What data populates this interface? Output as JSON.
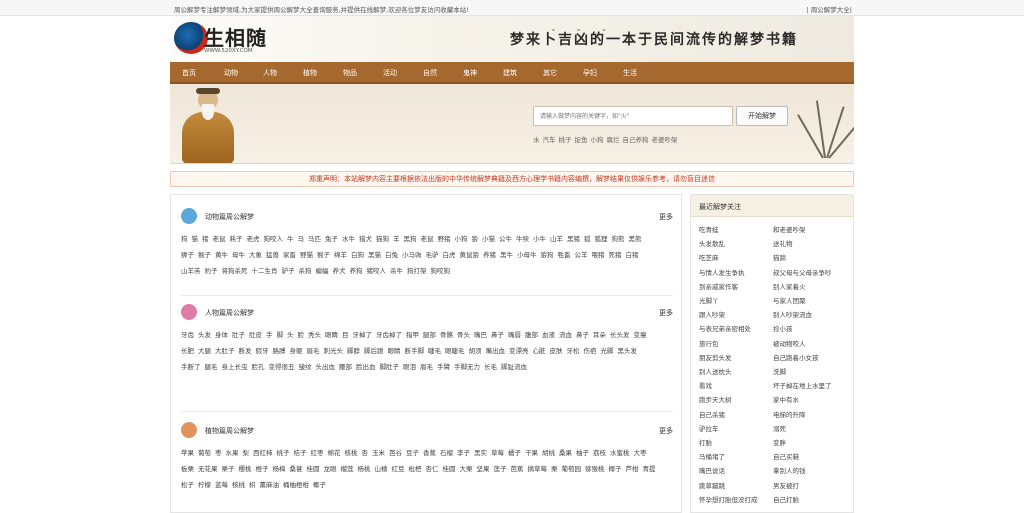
{
  "topbar": {
    "notice": "周公解梦专注解梦领域,为大家提供周公解梦大全查询服务,并提供在线解梦,欢迎各位梦友访问收藏本站!",
    "right_link": "| 周公解梦大全|"
  },
  "header": {
    "logo_name": "生相随",
    "logo_url": "WWW.520XY.COM",
    "slogan": "梦来卜吉凶的一本于民间流传的解梦书籍"
  },
  "nav": [
    "首页",
    "动物",
    "人物",
    "植物",
    "物品",
    "活动",
    "自然",
    "鬼神",
    "建筑",
    "其它",
    "孕妇",
    "生活"
  ],
  "search": {
    "placeholder": "请输入做梦内容的关键字，如\"火\"",
    "button_label": "开始解梦",
    "hot_words": [
      "水",
      "汽车",
      "桃子",
      "捉鱼",
      "小狗",
      "腐烂",
      "自己养狗",
      "老婆吵架"
    ]
  },
  "disclaimer": "郑重声明：本站解梦内容主要根据依法出版的中华传统解梦典籍及西方心理学书籍内容编撰，解梦结果仅供娱乐参考，请勿盲目迷信",
  "sections": [
    {
      "title": "动物篇周公解梦",
      "more": "更多",
      "icon_color": "#5aa9d8",
      "words": [
        "狗",
        "猫",
        "猪",
        "老鼠",
        "耗子",
        "老虎",
        "狗咬人",
        "牛",
        "马",
        "马匹",
        "兔子",
        "水牛",
        "猎犬",
        "猫狗",
        "羊",
        "黑狗",
        "老鼠",
        "野猪",
        "小狗",
        "狼",
        "小猫",
        "公牛",
        "牛犊",
        "小牛",
        "山羊",
        "黑猪",
        "狐",
        "狐狸",
        "狗熊",
        "黑熊",
        "狮子",
        "猴子",
        "黄牛",
        "母牛",
        "大象",
        "猛兽",
        "家畜",
        "野猫",
        "猴子",
        "绵羊",
        "白狗",
        "黑猫",
        "白兔",
        "小马驹",
        "毛驴",
        "白虎",
        "黄鼠狼",
        "养猪",
        "黑牛",
        "小母牛",
        "狼狗",
        "牲畜",
        "公羊",
        "喂猪",
        "死猪",
        "白猪",
        "山羊羔",
        "豹子",
        "将狗杀死",
        "十二生肖",
        "驴子",
        "杀狗",
        "蝙蝠",
        "养犬",
        "养狗",
        "猪咬人",
        "杀牛",
        "狗打架",
        "狗咬狗"
      ]
    },
    {
      "title": "人物篇周公解梦",
      "more": "更多",
      "icon_color": "#e07aa8",
      "words": [
        "牙齿",
        "头发",
        "身体",
        "肚子",
        "肚皮",
        "手",
        "脚",
        "头",
        "脸",
        "秃头",
        "眼睛",
        "目",
        "牙掉了",
        "牙齿掉了",
        "指甲",
        "腿部",
        "骨骼",
        "骨头",
        "嘴巴",
        "鼻子",
        "嘴唇",
        "腹部",
        "血液",
        "流血",
        "鼻子",
        "耳朵",
        "长头发",
        "变瘦",
        "长肥",
        "大腿",
        "大肚子",
        "断发",
        "假牙",
        "胳膊",
        "身躯",
        "眉毛",
        "刺光头",
        "脚脖",
        "脚后跟",
        "眼睛",
        "断手脚",
        "睫毛",
        "眼睫毛",
        "胡须",
        "嘴出血",
        "变漂亮",
        "心脏",
        "皮肤",
        "牙松",
        "伤疤",
        "光脚",
        "黑头发",
        "手断了",
        "腿毛",
        "身上长虫",
        "脸孔",
        "变得很丑",
        "皱纹",
        "头出血",
        "腰部",
        "脸出血",
        "脚肚子",
        "眼泪",
        "眉毛",
        "手臂",
        "手脚无力",
        "长毛",
        "脚趾流血"
      ]
    },
    {
      "title": "植物篇周公解梦",
      "more": "更多",
      "icon_color": "#e0935a",
      "words": [
        "苹果",
        "葡萄",
        "枣",
        "水果",
        "梨",
        "西红柿",
        "桃子",
        "桔子",
        "红枣",
        "棉花",
        "核桃",
        "杏",
        "玉米",
        "芭谷",
        "豆子",
        "香蕉",
        "石榴",
        "李子",
        "黑实",
        "草莓",
        "橘子",
        "干果",
        "胡桃",
        "桑果",
        "柚子",
        "荔枝",
        "水蜜桃",
        "大枣",
        "板栗",
        "无花果",
        "栗子",
        "樱桃",
        "橙子",
        "杨梅",
        "桑葚",
        "桂圆",
        "龙眼",
        "榴莲",
        "杨桃",
        "山楂",
        "红豆",
        "枇杷",
        "杏仁",
        "桂圆",
        "大栗",
        "坚果",
        "莲子",
        "芭蕉",
        "摘草莓",
        "栗",
        "葡萄园",
        "猕猴桃",
        "椰子",
        "芦柑",
        "青提",
        "松子",
        "柠檬",
        "蓝莓",
        "核桃",
        "枳",
        "薰麻油",
        "桶柚橙柑",
        "椰子"
      ]
    }
  ],
  "sidebar": {
    "title": "最近解梦关注",
    "left": [
      "吃青蛙",
      "头发散乱",
      "吃芝麻",
      "与情人发生争执",
      "到亲戚家作客",
      "光脚丫",
      "跟人吵架",
      "与表兄弟亲密相处",
      "旅行包",
      "朋友剪头发",
      "别人送枕头",
      "看戏",
      "跑步天大树",
      "自己杀猪",
      "驴拉车",
      "打胎",
      "马桶堵了",
      "嘴巴说话",
      "跳草蹦跳",
      "怀孕想打胎但没打成"
    ],
    "right": [
      "和老婆吵架",
      "送礼物",
      "猫蹄",
      "叔父母与父母亲争吵",
      "别人家着火",
      "与家人团聚",
      "别人吵架流血",
      "捡小孩",
      "被动物咬人",
      "自己跑着小女孩",
      "洗脚",
      "坏子掉在地上水里了",
      "家中有水",
      "电梯的升降",
      "溺死",
      "变胖",
      "自己买鞋",
      "拿别人的钱",
      "男友被打",
      "自己打胎"
    ]
  }
}
